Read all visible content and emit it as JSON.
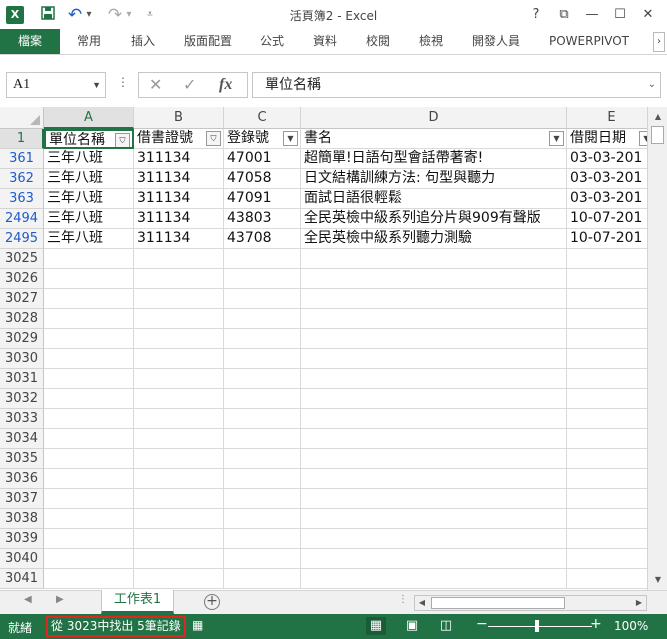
{
  "window": {
    "title": "活頁簿2 - Excel",
    "help": "?",
    "restore_ribbon": "⧉",
    "minimize": "—",
    "maximize": "☐",
    "close": "✕"
  },
  "qat": {
    "app_icon": "X",
    "save_icon": "save-icon",
    "undo": "↶",
    "undo_dd": "▾",
    "redo": "↷",
    "redo_dd": "▾",
    "customize": "⩡"
  },
  "ribbon": {
    "file_tab": "檔案",
    "tabs": [
      "常用",
      "插入",
      "版面配置",
      "公式",
      "資料",
      "校閱",
      "檢視",
      "開發人員",
      "POWERPIVOT"
    ],
    "scroll_arrow": "›"
  },
  "formula_bar": {
    "name_box": "A1",
    "cancel": "✕",
    "enter": "✓",
    "fx": "fx",
    "formula": "單位名稱"
  },
  "grid": {
    "columns": [
      "A",
      "B",
      "C",
      "D",
      "E"
    ],
    "header_row": {
      "row": "1",
      "cells": [
        "單位名稱",
        "借書證號",
        "登錄號",
        "書名",
        "借閱日期"
      ],
      "filter_active": [
        true,
        true,
        false,
        false,
        false
      ]
    },
    "data_rows": [
      {
        "row": "361",
        "cells": [
          "三年八班",
          "311134",
          "47001",
          "超簡單!日語句型會話帶著寄!",
          "03-03-201"
        ]
      },
      {
        "row": "362",
        "cells": [
          "三年八班",
          "311134",
          "47058",
          "日文結構訓練方法: 句型與聽力",
          "03-03-201"
        ]
      },
      {
        "row": "363",
        "cells": [
          "三年八班",
          "311134",
          "47091",
          "面試日語很輕鬆",
          "03-03-201"
        ]
      },
      {
        "row": "2494",
        "cells": [
          "三年八班",
          "311134",
          "43803",
          "全民英檢中級系列追分片與909有聲版",
          "10-07-201"
        ]
      },
      {
        "row": "2495",
        "cells": [
          "三年八班",
          "311134",
          "43708",
          "全民英檢中級系列聽力測驗",
          "10-07-201"
        ]
      }
    ],
    "empty_rows": [
      "3025",
      "3026",
      "3027",
      "3028",
      "3029",
      "3030",
      "3031",
      "3032",
      "3033",
      "3034",
      "3035",
      "3036",
      "3037",
      "3038",
      "3039",
      "3040",
      "3041"
    ]
  },
  "sheets": {
    "active": "工作表1",
    "add": "+"
  },
  "status": {
    "ready": "就緒",
    "filter_message": "從 3023中找出 5筆記錄",
    "zoom_percent": "100%",
    "zoom_value": 100
  }
}
